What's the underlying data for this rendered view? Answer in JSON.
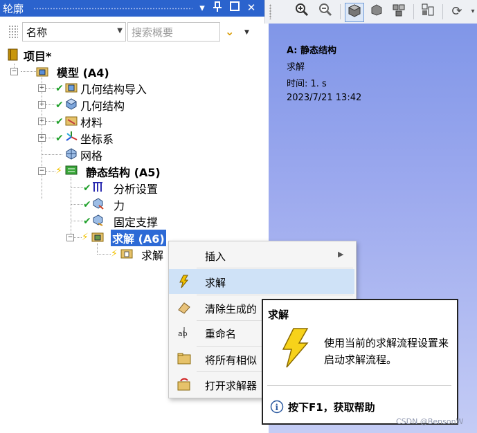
{
  "outline": {
    "title": "轮廓",
    "filter_field": "名称",
    "search_placeholder": "搜索概要"
  },
  "tree": {
    "project": "项目*",
    "model": "模型 (A4)",
    "geometry_import": "几何结构导入",
    "geometry": "几何结构",
    "materials": "材料",
    "coordinate_systems": "坐标系",
    "mesh": "网格",
    "static_structural": "静态结构 (A5)",
    "analysis_settings": "分析设置",
    "force": "力",
    "fixed_support": "固定支撑",
    "solution": "求解 (A6)",
    "solution_info": "求解"
  },
  "viewport": {
    "title": "A: 静态结构",
    "subtitle": "求解",
    "time": "时间: 1. s",
    "timestamp": "2023/7/21 13:42"
  },
  "context_menu": {
    "items": [
      {
        "label": "插入",
        "icon": "none"
      },
      {
        "label": "求解",
        "icon": "lightning-icon"
      },
      {
        "label": "清除生成的",
        "icon": "eraser-icon"
      },
      {
        "label": "重命名",
        "icon": "rename-icon"
      },
      {
        "label": "将所有相似",
        "icon": "folder-icon"
      },
      {
        "label": "打开求解器",
        "icon": "folder-open-icon"
      }
    ]
  },
  "tooltip": {
    "title": "求解",
    "body": "使用当前的求解流程设置来启动求解流程。",
    "help": "按下F1，获取帮助"
  },
  "watermark": "CSDN @BensonW",
  "colors": {
    "title_bar": "#2b63cd",
    "selection": "#2d6ad6",
    "menu_hover": "#cfe2f7",
    "status_ok": "#1fa02a",
    "status_pending": "#f2c200"
  }
}
